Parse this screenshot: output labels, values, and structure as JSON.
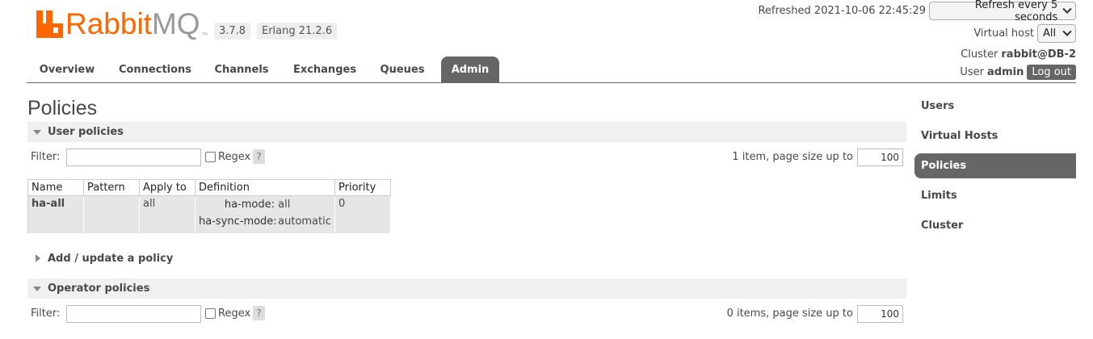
{
  "app": {
    "logo_rabbit": "Rabbit",
    "logo_mq": "MQ",
    "logo_tm": "TM",
    "version": "3.7.8",
    "erlang": "Erlang 21.2.6"
  },
  "header": {
    "refreshed": "Refreshed 2021-10-06 22:45:29",
    "refresh_select": "Refresh every 5 seconds",
    "vhost_label": "Virtual host",
    "vhost_select": "All",
    "cluster_label": "Cluster",
    "cluster_name": "rabbit@DB-2",
    "user_label": "User",
    "user_name": "admin",
    "logout": "Log out"
  },
  "tabs": [
    "Overview",
    "Connections",
    "Channels",
    "Exchanges",
    "Queues",
    "Admin"
  ],
  "active_tab": "Admin",
  "page_title": "Policies",
  "user_policies": {
    "header": "User policies",
    "filter_label": "Filter:",
    "filter_value": "",
    "regex_label": "Regex",
    "help": "?",
    "page_info": "1 item, page size up to",
    "page_size": "100",
    "columns": [
      "Name",
      "Pattern",
      "Apply to",
      "Definition",
      "Priority"
    ],
    "rows": [
      {
        "name": "ha-all",
        "pattern": "",
        "apply_to": "all",
        "definition": [
          {
            "key": "ha-mode:",
            "value": "all"
          },
          {
            "key": "ha-sync-mode:",
            "value": "automatic"
          }
        ],
        "priority": "0"
      }
    ]
  },
  "add_policy": {
    "header": "Add / update a policy"
  },
  "operator_policies": {
    "header": "Operator policies",
    "filter_label": "Filter:",
    "filter_value": "",
    "regex_label": "Regex",
    "help": "?",
    "page_info": "0 items, page size up to",
    "page_size": "100"
  },
  "subnav": [
    "Users",
    "Virtual Hosts",
    "Policies",
    "Limits",
    "Cluster"
  ],
  "subnav_active": "Policies",
  "colors": {
    "brand": "#ff6600",
    "nav_active": "#666666"
  }
}
